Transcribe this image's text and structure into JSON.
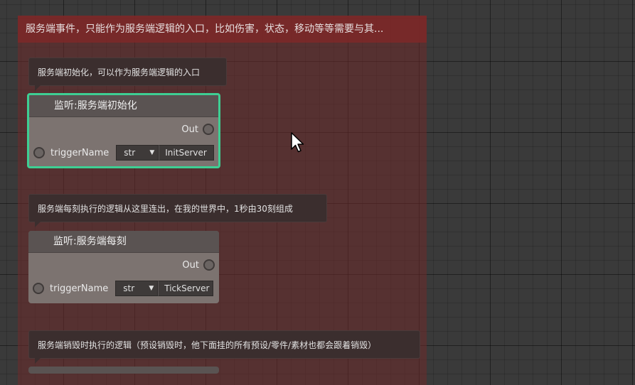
{
  "group": {
    "header": "服务端事件，只能作为服务端逻辑的入口，比如伤害，状态，移动等等需要与其..."
  },
  "comments": [
    "服务端初始化，可以作为服务端逻辑的入口",
    "服务端每刻执行的逻辑从这里连出，在我的世界中，1秒由30刻组成",
    "服务端销毁时执行的逻辑（预设销毁时，他下面挂的所有预设/零件/素材也都会跟着销毁）"
  ],
  "nodes": [
    {
      "title": "监听:服务端初始化",
      "out_label": "Out",
      "param_label": "triggerName",
      "type_value": "str",
      "value": "InitServer"
    },
    {
      "title": "监听:服务端每刻",
      "out_label": "Out",
      "param_label": "triggerName",
      "type_value": "str",
      "value": "TickServer"
    }
  ],
  "colors": {
    "selection": "#3ecf93",
    "group_bg": "#6e2a2a",
    "node_body": "#7c7370",
    "node_title": "#5a5352"
  }
}
